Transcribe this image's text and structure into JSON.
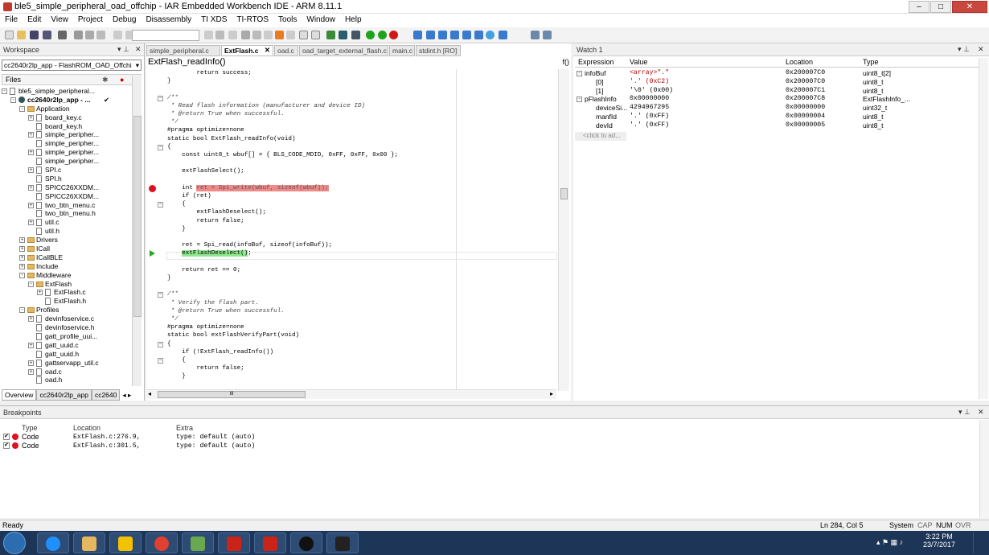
{
  "window": {
    "title": "ble5_simple_peripheral_oad_offchip - IAR Embedded Workbench IDE - ARM 8.11.1",
    "min": "–",
    "max": "□",
    "close": "✕"
  },
  "menu": [
    "File",
    "Edit",
    "View",
    "Project",
    "Debug",
    "Disassembly",
    "TI XDS",
    "TI-RTOS",
    "Tools",
    "Window",
    "Help"
  ],
  "workspace": {
    "title": "Workspace",
    "config": "cc2640r2lp_app - FlashROM_OAD_Offchi",
    "files_header": "Files",
    "tree": [
      {
        "label": "ble5_simple_peripheral...",
        "depth": 0,
        "icon": "file",
        "exp": "-"
      },
      {
        "label": "cc2640r2lp_app - ...",
        "depth": 1,
        "icon": "proj",
        "exp": "-",
        "bold": true,
        "check": "✔"
      },
      {
        "label": "Application",
        "depth": 2,
        "icon": "folder",
        "exp": "-"
      },
      {
        "label": "board_key.c",
        "depth": 3,
        "icon": "file",
        "exp": "+"
      },
      {
        "label": "board_key.h",
        "depth": 3,
        "icon": "file",
        "exp": ""
      },
      {
        "label": "simple_peripher...",
        "depth": 3,
        "icon": "file",
        "exp": "+"
      },
      {
        "label": "simple_peripher...",
        "depth": 3,
        "icon": "file",
        "exp": ""
      },
      {
        "label": "simple_peripher...",
        "depth": 3,
        "icon": "file",
        "exp": "+"
      },
      {
        "label": "simple_peripher...",
        "depth": 3,
        "icon": "file",
        "exp": ""
      },
      {
        "label": "SPI.c",
        "depth": 3,
        "icon": "file",
        "exp": "+"
      },
      {
        "label": "SPI.h",
        "depth": 3,
        "icon": "file",
        "exp": ""
      },
      {
        "label": "SPICC26XXDM...",
        "depth": 3,
        "icon": "file",
        "exp": "+"
      },
      {
        "label": "SPICC26XXDM...",
        "depth": 3,
        "icon": "file",
        "exp": ""
      },
      {
        "label": "two_btn_menu.c",
        "depth": 3,
        "icon": "file",
        "exp": "+"
      },
      {
        "label": "two_btn_menu.h",
        "depth": 3,
        "icon": "file",
        "exp": ""
      },
      {
        "label": "util.c",
        "depth": 3,
        "icon": "file",
        "exp": "+"
      },
      {
        "label": "util.h",
        "depth": 3,
        "icon": "file",
        "exp": ""
      },
      {
        "label": "Drivers",
        "depth": 2,
        "icon": "folder",
        "exp": "+"
      },
      {
        "label": "ICall",
        "depth": 2,
        "icon": "folder",
        "exp": "+"
      },
      {
        "label": "ICallBLE",
        "depth": 2,
        "icon": "folder",
        "exp": "+"
      },
      {
        "label": "Include",
        "depth": 2,
        "icon": "folder",
        "exp": "+"
      },
      {
        "label": "Middleware",
        "depth": 2,
        "icon": "folder",
        "exp": "-"
      },
      {
        "label": "ExtFlash",
        "depth": 3,
        "icon": "folder",
        "exp": "-"
      },
      {
        "label": "ExtFlash.c",
        "depth": 4,
        "icon": "file",
        "exp": "+"
      },
      {
        "label": "ExtFlash.h",
        "depth": 4,
        "icon": "file",
        "exp": ""
      },
      {
        "label": "Profiles",
        "depth": 2,
        "icon": "folder",
        "exp": "-"
      },
      {
        "label": "devinfoservice.c",
        "depth": 3,
        "icon": "file",
        "exp": "+"
      },
      {
        "label": "devinfoservice.h",
        "depth": 3,
        "icon": "file",
        "exp": ""
      },
      {
        "label": "gatt_profile_uui...",
        "depth": 3,
        "icon": "file",
        "exp": ""
      },
      {
        "label": "gatt_uuid.c",
        "depth": 3,
        "icon": "file",
        "exp": "+"
      },
      {
        "label": "gatt_uuid.h",
        "depth": 3,
        "icon": "file",
        "exp": ""
      },
      {
        "label": "gattservapp_util.c",
        "depth": 3,
        "icon": "file",
        "exp": "+"
      },
      {
        "label": "oad.c",
        "depth": 3,
        "icon": "file",
        "exp": "+"
      },
      {
        "label": "oad.h",
        "depth": 3,
        "icon": "file",
        "exp": ""
      }
    ],
    "tabs": [
      "Overview",
      "cc2640r2lp_app",
      "cc2640"
    ]
  },
  "editor": {
    "tabs": [
      {
        "label": "simple_peripheral.c",
        "active": false
      },
      {
        "label": "ExtFlash.c",
        "active": true
      },
      {
        "label": "oad.c",
        "active": false
      },
      {
        "label": "oad_target_external_flash.c",
        "active": false
      },
      {
        "label": "main.c",
        "active": false
      },
      {
        "label": "stdint.h [RO]",
        "active": false
      }
    ],
    "function": "ExtFlash_readInfo()",
    "fo": "f()",
    "hscroll_mark": "III",
    "lines": [
      {
        "t": "        return success;",
        "c": ""
      },
      {
        "t": "}",
        "c": ""
      },
      {
        "t": "",
        "c": ""
      },
      {
        "t": "/**",
        "c": "cm"
      },
      {
        "t": " * Read flash information (manufacturer and device ID)",
        "c": "cm"
      },
      {
        "t": " * @return True when successful.",
        "c": "cm"
      },
      {
        "t": " */",
        "c": "cm"
      },
      {
        "t": "#pragma optimize=none",
        "c": ""
      },
      {
        "t": "static bool ExtFlash_readInfo(void)",
        "c": ""
      },
      {
        "t": "{",
        "c": ""
      },
      {
        "t": "    const uint8_t wbuf[] = { BLS_CODE_MDID, 0xFF, 0xFF, 0x00 };",
        "c": ""
      },
      {
        "t": "",
        "c": ""
      },
      {
        "t": "    extFlashSelect();",
        "c": ""
      },
      {
        "t": "",
        "c": ""
      },
      {
        "t": "    int ",
        "c": "",
        "hl": "ret = Spi_write(wbuf, sizeof(wbuf));",
        "hlc": "bp-hl",
        "after": ""
      },
      {
        "t": "    if (ret)",
        "c": ""
      },
      {
        "t": "    {",
        "c": ""
      },
      {
        "t": "        extFlashDeselect();",
        "c": ""
      },
      {
        "t": "        return false;",
        "c": ""
      },
      {
        "t": "    }",
        "c": ""
      },
      {
        "t": "",
        "c": ""
      },
      {
        "t": "    ret = Spi_read(infoBuf, sizeof(infoBuf));",
        "c": ""
      },
      {
        "t": "    ",
        "c": "",
        "hl": "extFlashDeselect()",
        "hlc": "cur-hl",
        "after": ";"
      },
      {
        "t": "",
        "c": ""
      },
      {
        "t": "    return ret == 0;",
        "c": ""
      },
      {
        "t": "}",
        "c": ""
      },
      {
        "t": "",
        "c": ""
      },
      {
        "t": "/**",
        "c": "cm"
      },
      {
        "t": " * Verify the flash part.",
        "c": "cm"
      },
      {
        "t": " * @return True when successful.",
        "c": "cm"
      },
      {
        "t": " */",
        "c": "cm"
      },
      {
        "t": "#pragma optimize=none",
        "c": ""
      },
      {
        "t": "static bool extFlashVerifyPart(void)",
        "c": ""
      },
      {
        "t": "{",
        "c": ""
      },
      {
        "t": "    if (!ExtFlash_readInfo())",
        "c": ""
      },
      {
        "t": "    {",
        "c": ""
      },
      {
        "t": "        return false;",
        "c": ""
      },
      {
        "t": "    }",
        "c": ""
      }
    ]
  },
  "watch": {
    "title": "Watch 1",
    "headers": [
      "Expression",
      "Value",
      "Location",
      "Type"
    ],
    "rows": [
      {
        "exp": "-",
        "indent": 0,
        "name": "infoBuf",
        "value": "<array>\".\"",
        "loc": "0x200007C0",
        "type": "uint8_t[2]",
        "red": true
      },
      {
        "exp": "",
        "indent": 1,
        "name": "[0]",
        "value": "'.' (0xC2)",
        "loc": "0x200007C0",
        "type": "uint8_t",
        "red": true
      },
      {
        "exp": "",
        "indent": 1,
        "name": "[1]",
        "value": "'\\0' (0x00)",
        "loc": "0x200007C1",
        "type": "uint8_t",
        "red": false
      },
      {
        "exp": "-",
        "indent": 0,
        "name": "pFlashInfo",
        "value": "0x00000000",
        "loc": "0x200007C8",
        "type": "ExtFlashInfo_...",
        "red": false
      },
      {
        "exp": "",
        "indent": 1,
        "name": "deviceSi...",
        "value": "4294967295",
        "loc": "0x00000000",
        "type": "uint32_t",
        "red": false
      },
      {
        "exp": "",
        "indent": 1,
        "name": "manfId",
        "value": "'.' (0xFF)",
        "loc": "0x00000004",
        "type": "uint8_t",
        "red": false
      },
      {
        "exp": "",
        "indent": 1,
        "name": "devId",
        "value": "'.' (0xFF)",
        "loc": "0x00000005",
        "type": "uint8_t",
        "red": false
      }
    ],
    "add_placeholder": "<click to ad..."
  },
  "breakpoints": {
    "title": "Breakpoints",
    "headers": [
      "Type",
      "Location",
      "Extra"
    ],
    "rows": [
      {
        "checked": "✔",
        "type": "Code",
        "loc": "ExtFlash.c:276.9,",
        "extra": "type: default (auto)"
      },
      {
        "checked": "✔",
        "type": "Code",
        "loc": "ExtFlash.c:301.5,",
        "extra": "type: default (auto)"
      }
    ]
  },
  "status": {
    "left": "Ready",
    "pos": "Ln 284, Col 5",
    "mode": "System",
    "caps": "CAP",
    "num": "NUM",
    "ovr": "OVR"
  },
  "taskbar": {
    "time": "3:22 PM",
    "date": "23/7/2017"
  }
}
